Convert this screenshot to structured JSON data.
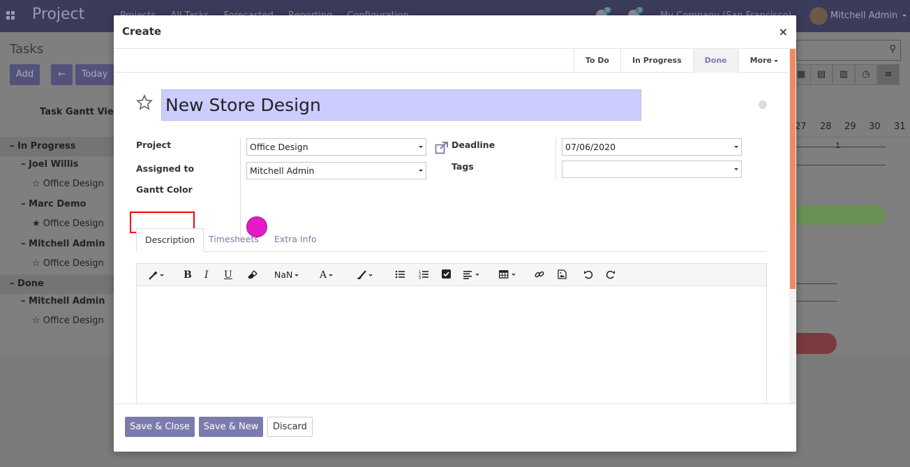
{
  "app": {
    "name": "Project",
    "menu": [
      "Projects",
      "All Tasks",
      "Forecasted",
      "Reporting",
      "Configuration"
    ],
    "activity_count": "9",
    "message_count": "3",
    "company": "My Company (San Francisco)",
    "user": "Mitchell Admin"
  },
  "background": {
    "breadcrumb": "Tasks",
    "add_label": "Add",
    "today_label": "Today",
    "gantt_header": "Task Gantt View",
    "rows": [
      {
        "label": "In Progress",
        "kind": "group"
      },
      {
        "label": "Joel Willis",
        "kind": "sub"
      },
      {
        "label": "Office Design",
        "kind": "task",
        "starred": false
      },
      {
        "label": "Marc Demo",
        "kind": "sub"
      },
      {
        "label": "Office Design",
        "kind": "task",
        "starred": true
      },
      {
        "label": "Mitchell Admin",
        "kind": "sub"
      },
      {
        "label": "Office Design",
        "kind": "task",
        "starred": false
      },
      {
        "label": "Done",
        "kind": "group"
      },
      {
        "label": "Mitchell Admin",
        "kind": "sub"
      },
      {
        "label": "Office Design",
        "kind": "task",
        "starred": false
      }
    ],
    "days": [
      "27",
      "28",
      "29",
      "30",
      "31"
    ],
    "bar_count": "1"
  },
  "modal": {
    "title": "Create",
    "close_glyph": "×",
    "stages": [
      {
        "label": "To Do",
        "active": false
      },
      {
        "label": "In Progress",
        "active": false
      },
      {
        "label": "Done",
        "active": true
      }
    ],
    "more_label": "More",
    "task_name": "New Store Design",
    "fields": {
      "project_label": "Project",
      "project_value": "Office Design",
      "assigned_label": "Assigned to",
      "assigned_value": "Mitchell Admin",
      "gantt_color_label": "Gantt Color",
      "gantt_color_value": "#e41bc7",
      "deadline_label": "Deadline",
      "deadline_value": "07/06/2020",
      "tags_label": "Tags",
      "tags_value": ""
    },
    "tabs": [
      {
        "label": "Description",
        "active": true
      },
      {
        "label": "Timesheets",
        "active": false
      },
      {
        "label": "Extra Info",
        "active": false
      }
    ],
    "editor": {
      "font_size_label": "NaN",
      "bold": "B",
      "italic": "I",
      "underline": "U",
      "font_color": "A",
      "content": ""
    },
    "footer": {
      "save_close": "Save & Close",
      "save_new": "Save & New",
      "discard": "Discard"
    }
  },
  "colors": {
    "primary": "#7c7bad",
    "scroll_accent": "#ef8a5f",
    "highlight_box": "#ff0000",
    "title_bg": "#ccccff"
  }
}
